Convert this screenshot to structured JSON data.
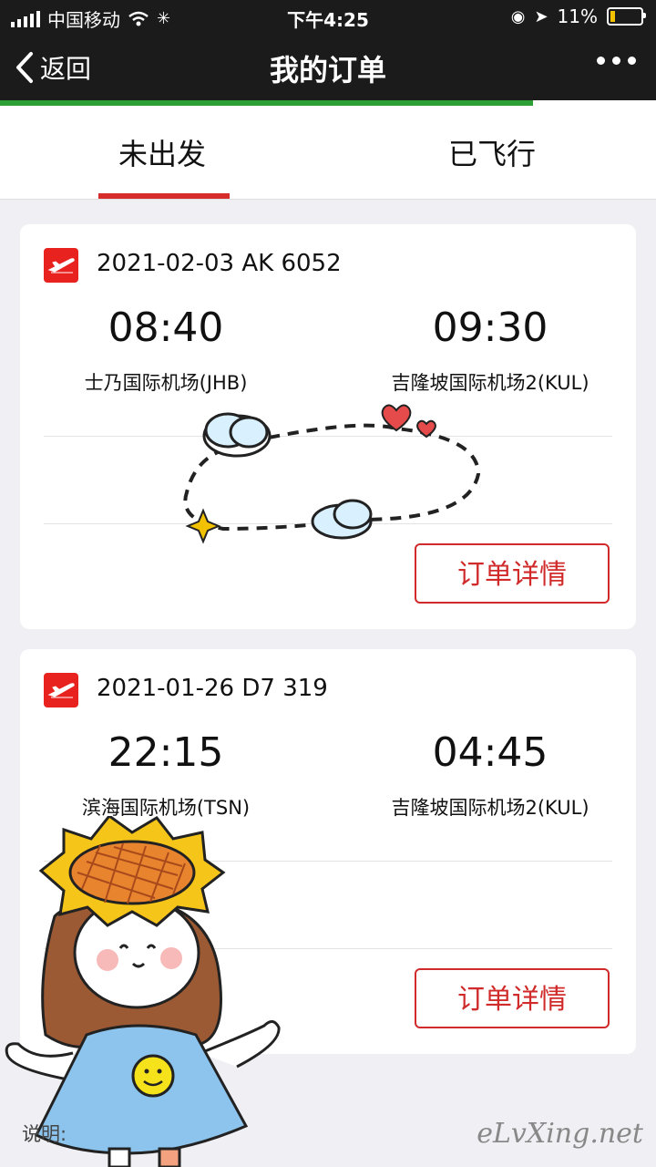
{
  "status_bar": {
    "carrier": "中国移动",
    "time": "下午4:25",
    "battery": "11%"
  },
  "nav": {
    "back_label": "返回",
    "title": "我的订单"
  },
  "tabs": [
    {
      "label": "未出发",
      "active": true
    },
    {
      "label": "已飞行",
      "active": false
    }
  ],
  "orders": [
    {
      "date_flight": "2021-02-03 AK 6052",
      "dep_time": "08:40",
      "arr_time": "09:30",
      "dep_airport": "士乃国际机场(JHB)",
      "arr_airport": "吉隆坡国际机场2(KUL)",
      "detail_button": "订单详情"
    },
    {
      "date_flight": "2021-01-26 D7 319",
      "dep_time": "22:15",
      "arr_time": "04:45",
      "dep_airport": "滨海国际机场(TSN)",
      "arr_airport": "吉隆坡国际机场2(KUL)",
      "detail_button": "订单详情"
    }
  ],
  "footer": {
    "note_label": "说明:",
    "watermark": "eLvXing.net"
  },
  "colors": {
    "accent_red": "#d02a2a",
    "progress_green": "#2ca034",
    "navbar": "#1b1b1b"
  },
  "icons": {
    "back": "chevron-left-icon",
    "more": "more-icon",
    "airline": "airplane-logo-icon"
  }
}
